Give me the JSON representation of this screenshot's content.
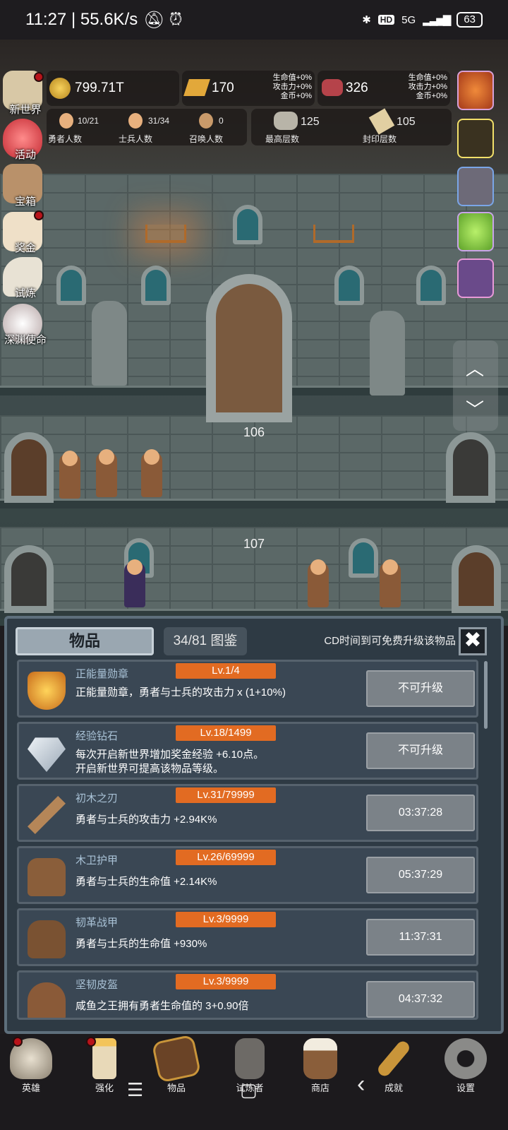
{
  "status_bar": {
    "time": "11:27 | 55.6K/s",
    "battery": "63",
    "network": "5G"
  },
  "resources": {
    "gold": "799.71T",
    "gold_bar": "170",
    "meat": "326",
    "bonus_lines": [
      "生命值+0%",
      "攻击力+0%",
      "金币+0%"
    ],
    "hero_count": "10/21",
    "hero_label": "勇者人数",
    "soldier_count": "31/34",
    "soldier_label": "士兵人数",
    "summon_count": "0",
    "summon_label": "召唤人数",
    "max_floor": "125",
    "max_floor_label": "最高层数",
    "seal_floor": "105",
    "seal_floor_label": "封印层数"
  },
  "left_menu": [
    "新世界",
    "活动",
    "宝箱",
    "奖金",
    "试炼",
    "深渊使命"
  ],
  "floors": {
    "floor_a": "106",
    "floor_b": "107"
  },
  "panel": {
    "title": "物品",
    "collection": "34/81 图鉴",
    "cd_text": "CD时间到可免费升级该物品",
    "close": "✖",
    "items": [
      {
        "name": "正能量勋章",
        "level": "Lv.1/4",
        "desc": "正能量勋章，勇者与士兵的攻击力 x (1+10%)",
        "button": "不可升级",
        "icon": "crown-icon"
      },
      {
        "name": "经验钻石",
        "level": "Lv.18/1499",
        "desc": "每次开启新世界增加奖金经验 +6.10点。\n开启新世界可提高该物品等级。",
        "button": "不可升级",
        "icon": "diamond-icon"
      },
      {
        "name": "初木之刃",
        "level": "Lv.31/79999",
        "desc": "勇者与士兵的攻击力 +2.94K%",
        "button": "03:37:28",
        "icon": "wooden-sword-icon"
      },
      {
        "name": "木卫护甲",
        "level": "Lv.26/69999",
        "desc": "勇者与士兵的生命值 +2.14K%",
        "button": "05:37:29",
        "icon": "wooden-armor-icon"
      },
      {
        "name": "韧革战甲",
        "level": "Lv.3/9999",
        "desc": "勇者与士兵的生命值 +930%",
        "button": "11:37:31",
        "icon": "leather-armor-icon"
      },
      {
        "name": "坚韧皮盔",
        "level": "Lv.3/9999",
        "desc": "咸鱼之王拥有勇者生命值的 3+0.90倍",
        "button": "04:37:32",
        "icon": "leather-helmet-icon"
      }
    ]
  },
  "bottom_nav": [
    "英雄",
    "强化",
    "物品",
    "试炼者",
    "商店",
    "成就",
    "设置"
  ],
  "system_nav": {
    "menu": "☰",
    "home": "▢",
    "back": "‹"
  }
}
